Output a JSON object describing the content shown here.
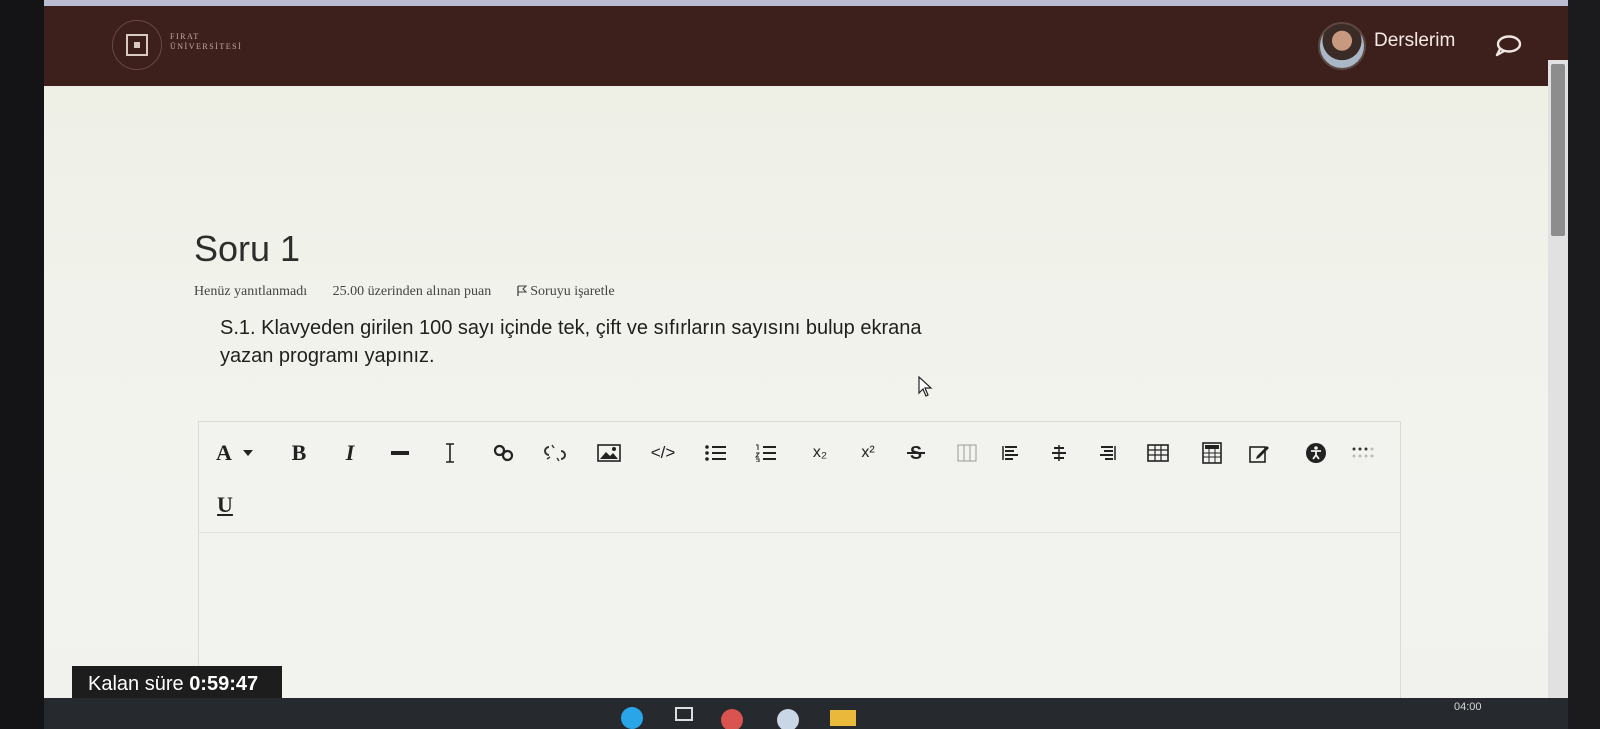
{
  "header": {
    "logo_text_line1": "FIRAT",
    "logo_text_line2": "ÜNİVERSİTESİ",
    "nav_courses": "Derslerim"
  },
  "question": {
    "title": "Soru 1",
    "status": "Henüz yanıtlanmadı",
    "grade": "25.00 üzerinden alınan puan",
    "flag_label": "Soruyu işaretle",
    "text_line1": "S.1. Klavyeden girilen 100 sayı içinde tek, çift ve sıfırların sayısını bulup ekrana",
    "text_line2": "yazan programı yapınız."
  },
  "toolbar": {
    "font_label": "A",
    "bold_label": "B",
    "italic_label": "I",
    "underline_label": "U",
    "subscript_label": "x₂",
    "superscript_label": "x²",
    "code_label": "</>"
  },
  "timer": {
    "label": "Kalan süre",
    "value": "0:59:47"
  },
  "taskbar": {
    "time": "04:00"
  }
}
